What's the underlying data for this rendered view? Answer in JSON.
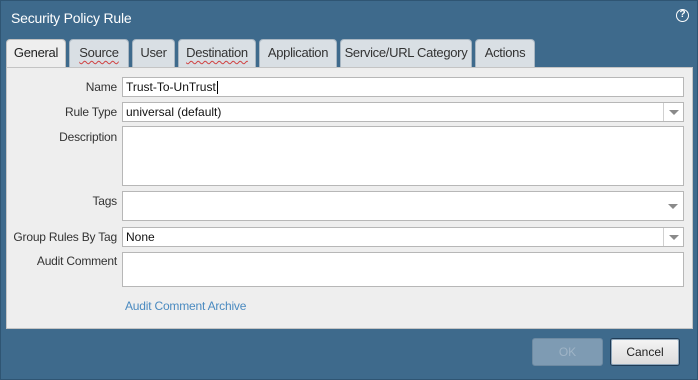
{
  "dialog": {
    "title": "Security Policy Rule",
    "help_icon": "help-icon"
  },
  "tabs": [
    {
      "label": "General",
      "active": true
    },
    {
      "label": "Source",
      "active": false
    },
    {
      "label": "User",
      "active": false
    },
    {
      "label": "Destination",
      "active": false
    },
    {
      "label": "Application",
      "active": false
    },
    {
      "label": "Service/URL Category",
      "active": false
    },
    {
      "label": "Actions",
      "active": false
    }
  ],
  "form": {
    "name_label": "Name",
    "name_value": "Trust-To-UnTrust",
    "rule_type_label": "Rule Type",
    "rule_type_value": "universal (default)",
    "description_label": "Description",
    "description_value": "",
    "tags_label": "Tags",
    "tags_value": "",
    "group_rules_label": "Group Rules By Tag",
    "group_rules_value": "None",
    "audit_comment_label": "Audit Comment",
    "audit_comment_value": "",
    "audit_archive_link": "Audit Comment Archive"
  },
  "buttons": {
    "ok_label": "OK",
    "ok_enabled": false,
    "cancel_label": "Cancel"
  }
}
